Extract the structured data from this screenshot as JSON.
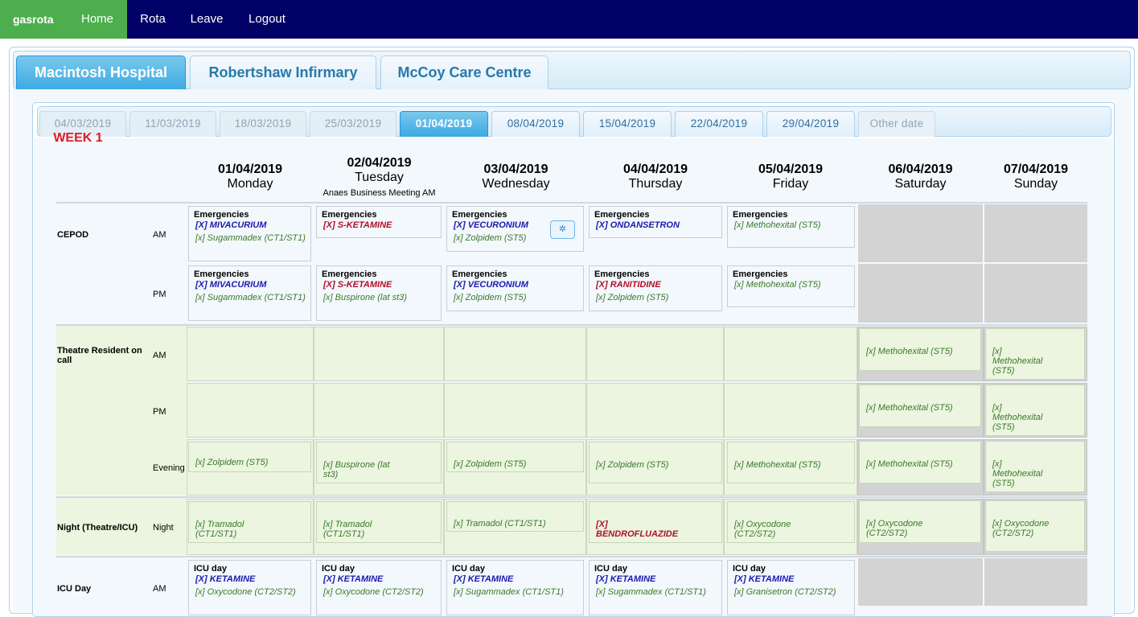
{
  "nav": {
    "brand": "gasrota",
    "items": [
      {
        "label": "Home",
        "active": true
      },
      {
        "label": "Rota",
        "active": false
      },
      {
        "label": "Leave",
        "active": false
      },
      {
        "label": "Logout",
        "active": false
      }
    ]
  },
  "hospital_tabs": [
    {
      "label": "Macintosh Hospital",
      "active": true
    },
    {
      "label": "Robertshaw Infirmary",
      "active": false
    },
    {
      "label": "McCoy Care Centre",
      "active": false
    }
  ],
  "date_tabs": [
    {
      "label": "04/03/2019",
      "state": "past"
    },
    {
      "label": "11/03/2019",
      "state": "past"
    },
    {
      "label": "18/03/2019",
      "state": "past"
    },
    {
      "label": "25/03/2019",
      "state": "past"
    },
    {
      "label": "01/04/2019",
      "state": "active"
    },
    {
      "label": "08/04/2019",
      "state": "future"
    },
    {
      "label": "15/04/2019",
      "state": "future"
    },
    {
      "label": "22/04/2019",
      "state": "future"
    },
    {
      "label": "29/04/2019",
      "state": "future"
    },
    {
      "label": "Other date",
      "state": "other"
    }
  ],
  "week_label": "WEEK 1",
  "days": [
    {
      "date": "01/04/2019",
      "name": "Monday",
      "note": ""
    },
    {
      "date": "02/04/2019",
      "name": "Tuesday",
      "note": "Anaes Business Meeting AM"
    },
    {
      "date": "03/04/2019",
      "name": "Wednesday",
      "note": ""
    },
    {
      "date": "04/04/2019",
      "name": "Thursday",
      "note": ""
    },
    {
      "date": "05/04/2019",
      "name": "Friday",
      "note": ""
    },
    {
      "date": "06/04/2019",
      "name": "Saturday",
      "note": ""
    },
    {
      "date": "07/04/2019",
      "name": "Sunday",
      "note": ""
    }
  ],
  "sections": {
    "cepod": {
      "label": "CEPOD",
      "am": "AM",
      "pm": "PM"
    },
    "theatre": {
      "label": "Theatre Resident on call",
      "am": "AM",
      "pm": "PM",
      "evening": "Evening"
    },
    "night": {
      "label": "Night (Theatre/ICU)",
      "night": "Night"
    },
    "icu": {
      "label": "ICU Day",
      "am": "AM"
    }
  },
  "titles": {
    "emergencies": "Emergencies",
    "icu_day": "ICU day"
  },
  "entries": {
    "mivacurium": "[X] MIVACURIUM",
    "s_ketamine": "[X] S-KETAMINE",
    "vecuronium": "[X] VECURONIUM",
    "ondansetron": "[X] ONDANSETRON",
    "ranitidine": "[X] RANITIDINE",
    "ketamine": "[X] KETAMINE",
    "bendro_a": "[X]",
    "bendro_b": "BENDROFLUAZIDE",
    "sugammadex_ct1": "[x] Sugammadex (CT1/ST1)",
    "zolpidem_st5": "[x] Zolpidem (ST5)",
    "methohexital_st5": "[x] Methohexital (ST5)",
    "buspirone": "[x] Buspirone (lat st3)",
    "tramadol_ct1": "[x] Tramadol (CT1/ST1)",
    "oxycodone_ct2": "[x] Oxycodone (CT2/ST2)",
    "granisetron_ct2": "[x] Granisetron (CT2/ST2)",
    "sugammadex_ct1_short": "[x] Sugammadex (CT1/ST1)"
  },
  "colors": {
    "nav_bg": "#000066",
    "nav_active": "#4cae4c",
    "week": "#e01b24",
    "accent": "#3baae3"
  },
  "icons": {
    "settings": "gear-icon"
  }
}
